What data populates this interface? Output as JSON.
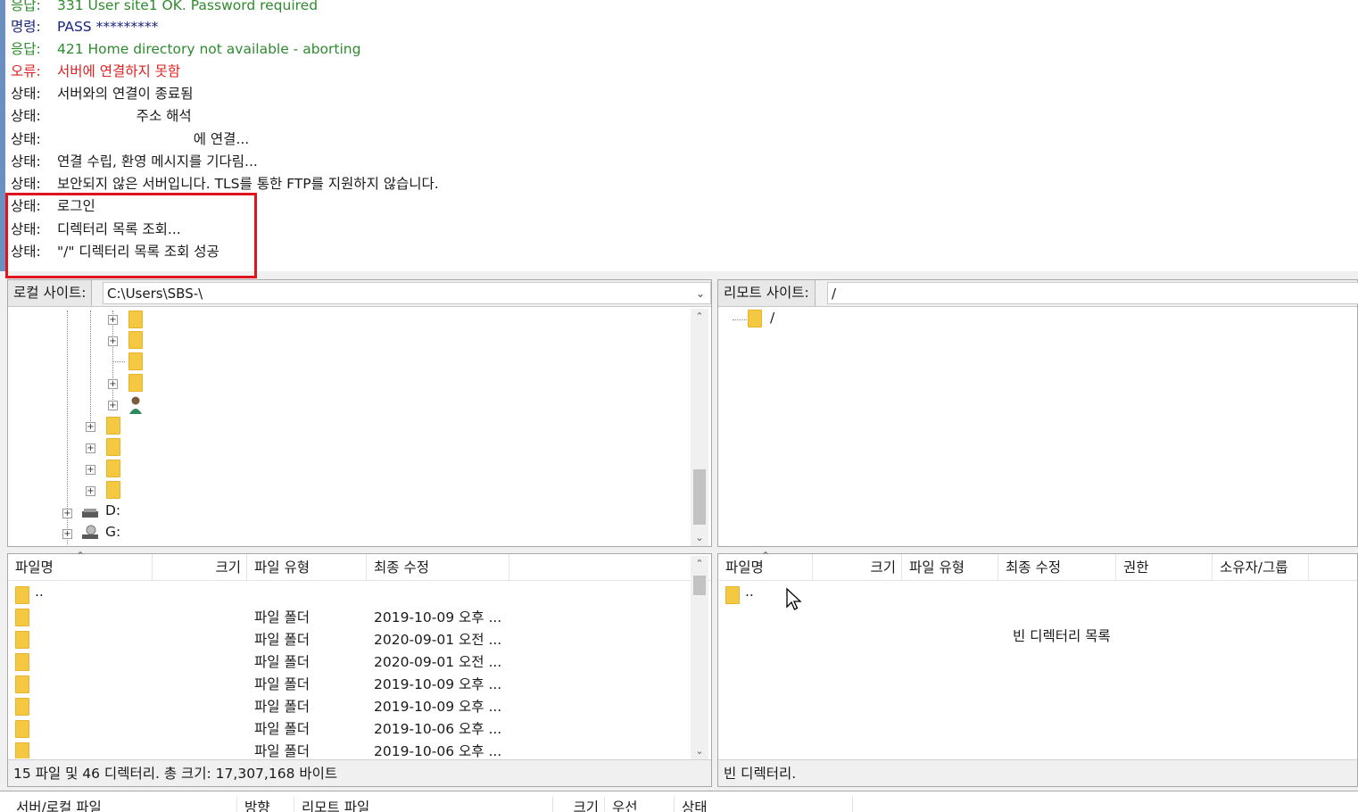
{
  "log": [
    {
      "label": "응답:",
      "text": "331 User site1 OK. Password required",
      "type": "resp"
    },
    {
      "label": "명령:",
      "text": "PASS *********",
      "type": "cmd"
    },
    {
      "label": "응답:",
      "text": "421 Home directory not available - aborting",
      "type": "resp"
    },
    {
      "label": "오류:",
      "text": "서버에 연결하지 못함",
      "type": "err"
    },
    {
      "label": "상태:",
      "text": "서버와의 연결이 종료됨",
      "type": "status"
    },
    {
      "label": "상태:",
      "text": "                  주소 해석",
      "type": "status"
    },
    {
      "label": "상태:",
      "text": "                               에 연결...",
      "type": "status"
    },
    {
      "label": "상태:",
      "text": "연결 수립, 환영 메시지를 기다림...",
      "type": "status"
    },
    {
      "label": "상태:",
      "text": "보안되지 않은 서버입니다. TLS를 통한 FTP를 지원하지 않습니다.",
      "type": "status"
    },
    {
      "label": "상태:",
      "text": "로그인",
      "type": "status"
    },
    {
      "label": "상태:",
      "text": "디렉터리 목록 조회...",
      "type": "status"
    },
    {
      "label": "상태:",
      "text": "\"/\" 디렉터리 목록 조회 성공",
      "type": "status"
    }
  ],
  "local": {
    "site_label": "로컬 사이트:",
    "path": "C:\\Users\\SBS-\\",
    "drives": [
      "D:",
      "G:"
    ],
    "columns": [
      "파일명",
      "크기",
      "파일 유형",
      "최종 수정"
    ],
    "parent_entry": "..",
    "rows": [
      {
        "type": "파일 폴더",
        "modified": "2019-10-09 오후 ..."
      },
      {
        "type": "파일 폴더",
        "modified": "2020-09-01 오전 ..."
      },
      {
        "type": "파일 폴더",
        "modified": "2020-09-01 오전 ..."
      },
      {
        "type": "파일 폴더",
        "modified": "2019-10-09 오후 ..."
      },
      {
        "type": "파일 폴더",
        "modified": "2019-10-09 오후 ..."
      },
      {
        "type": "파일 폴더",
        "modified": "2019-10-06 오후 ..."
      },
      {
        "type": "파일 폴더",
        "modified": "2019-10-06 오후 ..."
      }
    ],
    "status": "15 파일 및 46 디렉터리. 총 크기: 17,307,168 바이트"
  },
  "remote": {
    "site_label": "리모트 사이트:",
    "path": "/",
    "tree_root": "/",
    "columns": [
      "파일명",
      "크기",
      "파일 유형",
      "최종 수정",
      "권한",
      "소유자/그룹"
    ],
    "parent_entry": "..",
    "empty_message": "빈 디렉터리 목록",
    "status": "빈 디렉터리."
  },
  "queue": {
    "columns": [
      "서버/로컬 파일",
      "방향",
      "리모트 파일",
      "크기",
      "우선",
      "상태"
    ]
  },
  "colors": {
    "status": "#1a1a1a",
    "resp": "#2e8b2e",
    "cmd": "#1a237e",
    "err": "#e02020",
    "highlight": "#e0141e",
    "folder": "#f5c842"
  }
}
